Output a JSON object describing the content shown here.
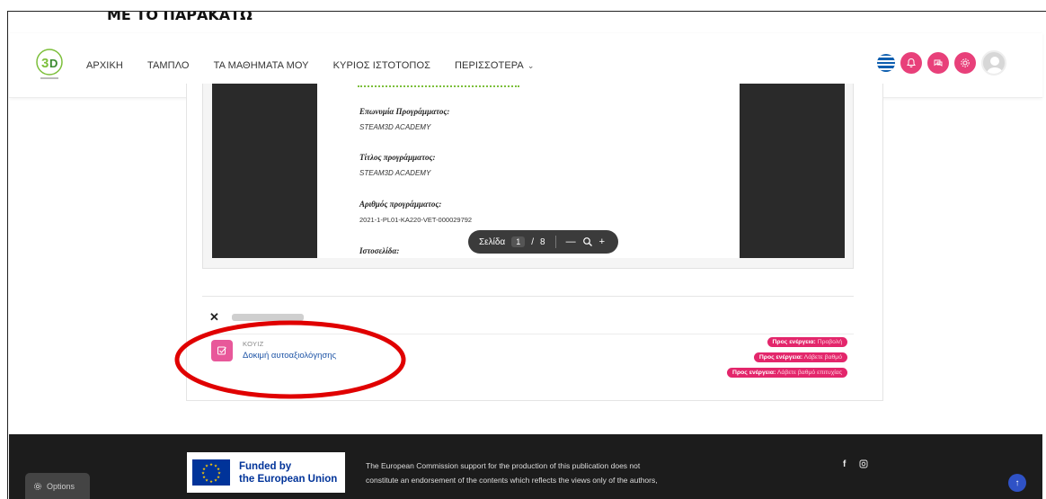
{
  "doc": {
    "header_text": "ΜΕ ΤΟ ΠΑΡΑΚΑΤΩ"
  },
  "navbar": {
    "items": [
      {
        "label": "ΑΡΧΙΚΗ"
      },
      {
        "label": "ΤΑΜΠΛΟ"
      },
      {
        "label": "ΤΑ ΜΑΘΗΜΑΤΑ ΜΟΥ"
      },
      {
        "label": "ΚΥΡΙΟΣ ΙΣΤΟΤΟΠΟΣ"
      },
      {
        "label": "ΠΕΡΙΣΣΟΤΕΡΑ"
      }
    ],
    "right_icons": [
      "greek-flag-icon",
      "bell-icon",
      "chat-icon",
      "gear-icon",
      "user-avatar-icon"
    ]
  },
  "pdf": {
    "fields": [
      {
        "label": "Επωνυμία Προγράμματος:",
        "value": "STEAM3D ACADEMY"
      },
      {
        "label": "Τίτλος προγράμματος:",
        "value": "STEAM3D ACADEMY"
      },
      {
        "label": "Αριθμός προγράμματος:",
        "value": "2021-1-PL01-KA220-VET-000029792"
      },
      {
        "label": "Ιστοσελίδα:",
        "value": ""
      }
    ],
    "toolbar": {
      "page_label": "Σελίδα",
      "current_page": "1",
      "separator": "/",
      "total_pages": "8"
    }
  },
  "activity": {
    "type_label": "ΚΟΥΙΖ",
    "title": "Δοκιμή αυτοαξιολόγησης",
    "badges": [
      {
        "prefix": "Προς ενέργεια:",
        "value": "Προβολή"
      },
      {
        "prefix": "Προς ενέργεια:",
        "value": "Λάβετε βαθμό"
      },
      {
        "prefix": "Προς ενέργεια:",
        "value": "Λάβετε βαθμό επιτυχίας"
      }
    ]
  },
  "footer": {
    "eu_line1": "Funded by",
    "eu_line2": "the European Union",
    "text_line1": "The European Commission support for the production of this publication does not",
    "text_line2": "constitute an endorsement of the contents which reflects the views only of the authors,",
    "options_label": "Options",
    "social": [
      "facebook-icon",
      "instagram-icon"
    ]
  },
  "colors": {
    "accent_pink": "#e8407a",
    "badge_pink": "#e3266b",
    "link_blue": "#1f55a6",
    "annotation_red": "#e00000"
  }
}
